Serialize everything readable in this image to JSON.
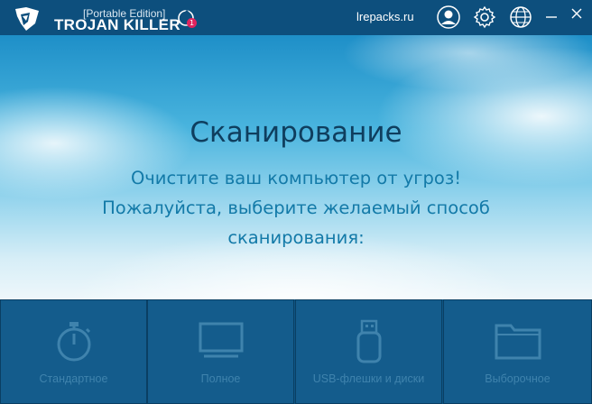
{
  "titlebar": {
    "edition": "[Portable Edition]",
    "product": "TROJAN KILLER",
    "notification_count": "1",
    "site_link": "lrepacks.ru"
  },
  "hero": {
    "title": "Сканирование",
    "lines": [
      "Очистите ваш компьютер от угроз!",
      "Пожалуйста, выберите желаемый способ",
      "сканирования:"
    ]
  },
  "tiles": [
    {
      "label": "Стандартное",
      "icon": "stopwatch-icon"
    },
    {
      "label": "Полное",
      "icon": "monitor-icon"
    },
    {
      "label": "USB-флешки и диски",
      "icon": "usb-drive-icon"
    },
    {
      "label": "Выборочное",
      "icon": "folder-icon"
    }
  ],
  "colors": {
    "titlebar_bg": "#0d4f7d",
    "tile_bg": "#145c8c",
    "tile_fg": "#3f83ad",
    "title_text": "#0f3e5e",
    "accent_text": "#137aa8",
    "badge": "#e0245e"
  }
}
